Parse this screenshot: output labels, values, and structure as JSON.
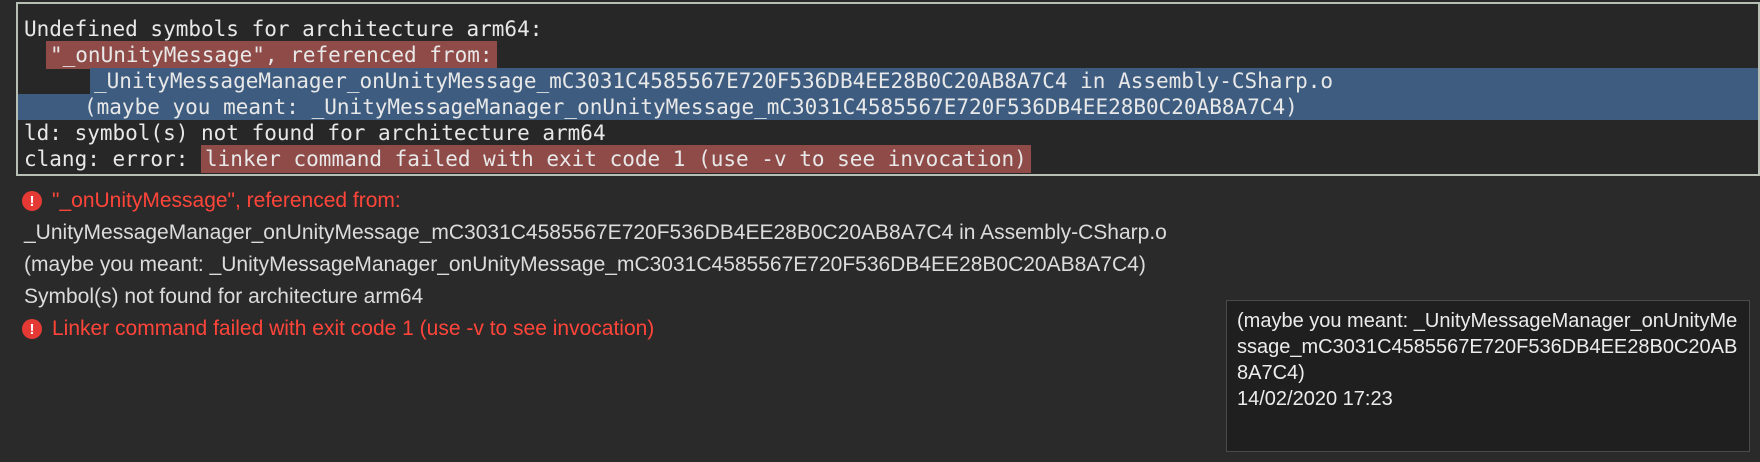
{
  "console": {
    "lines": [
      "Undefined symbols for architecture arm64:",
      "\"_onUnityMessage\", referenced from:",
      "_UnityMessageManager_onUnityMessage_mC3031C4585567E720F536DB4EE28B0C20AB8A7C4 in Assembly-CSharp.o",
      "(maybe you meant: _UnityMessageManager_onUnityMessage_mC3031C4585567E720F536DB4EE28B0C20AB8A7C4)",
      "ld: symbol(s) not found for architecture arm64",
      "clang: error: ",
      "linker command failed with exit code 1 (use -v to see invocation)"
    ]
  },
  "issues": [
    {
      "type": "error",
      "icon": "error-icon",
      "text": "\"_onUnityMessage\", referenced from:"
    },
    {
      "type": "note",
      "text": "_UnityMessageManager_onUnityMessage_mC3031C4585567E720F536DB4EE28B0C20AB8A7C4 in Assembly-CSharp.o"
    },
    {
      "type": "note",
      "text": "(maybe you meant: _UnityMessageManager_onUnityMessage_mC3031C4585567E720F536DB4EE28B0C20AB8A7C4)"
    },
    {
      "type": "note",
      "text": "Symbol(s) not found for architecture arm64"
    },
    {
      "type": "error",
      "icon": "error-icon",
      "text": "Linker command failed with exit code 1 (use -v to see invocation)"
    }
  ],
  "tooltip": {
    "text": "(maybe you meant: _UnityMessageManager_onUnityMessage_mC3031C4585567E720F536DB4EE28B0C20AB8A7C4)",
    "timestamp": "14/02/2020 17:23"
  },
  "colors": {
    "selection_red": "#8e4b48",
    "selection_blue": "#3d5c80",
    "error_red": "#ff453a"
  }
}
